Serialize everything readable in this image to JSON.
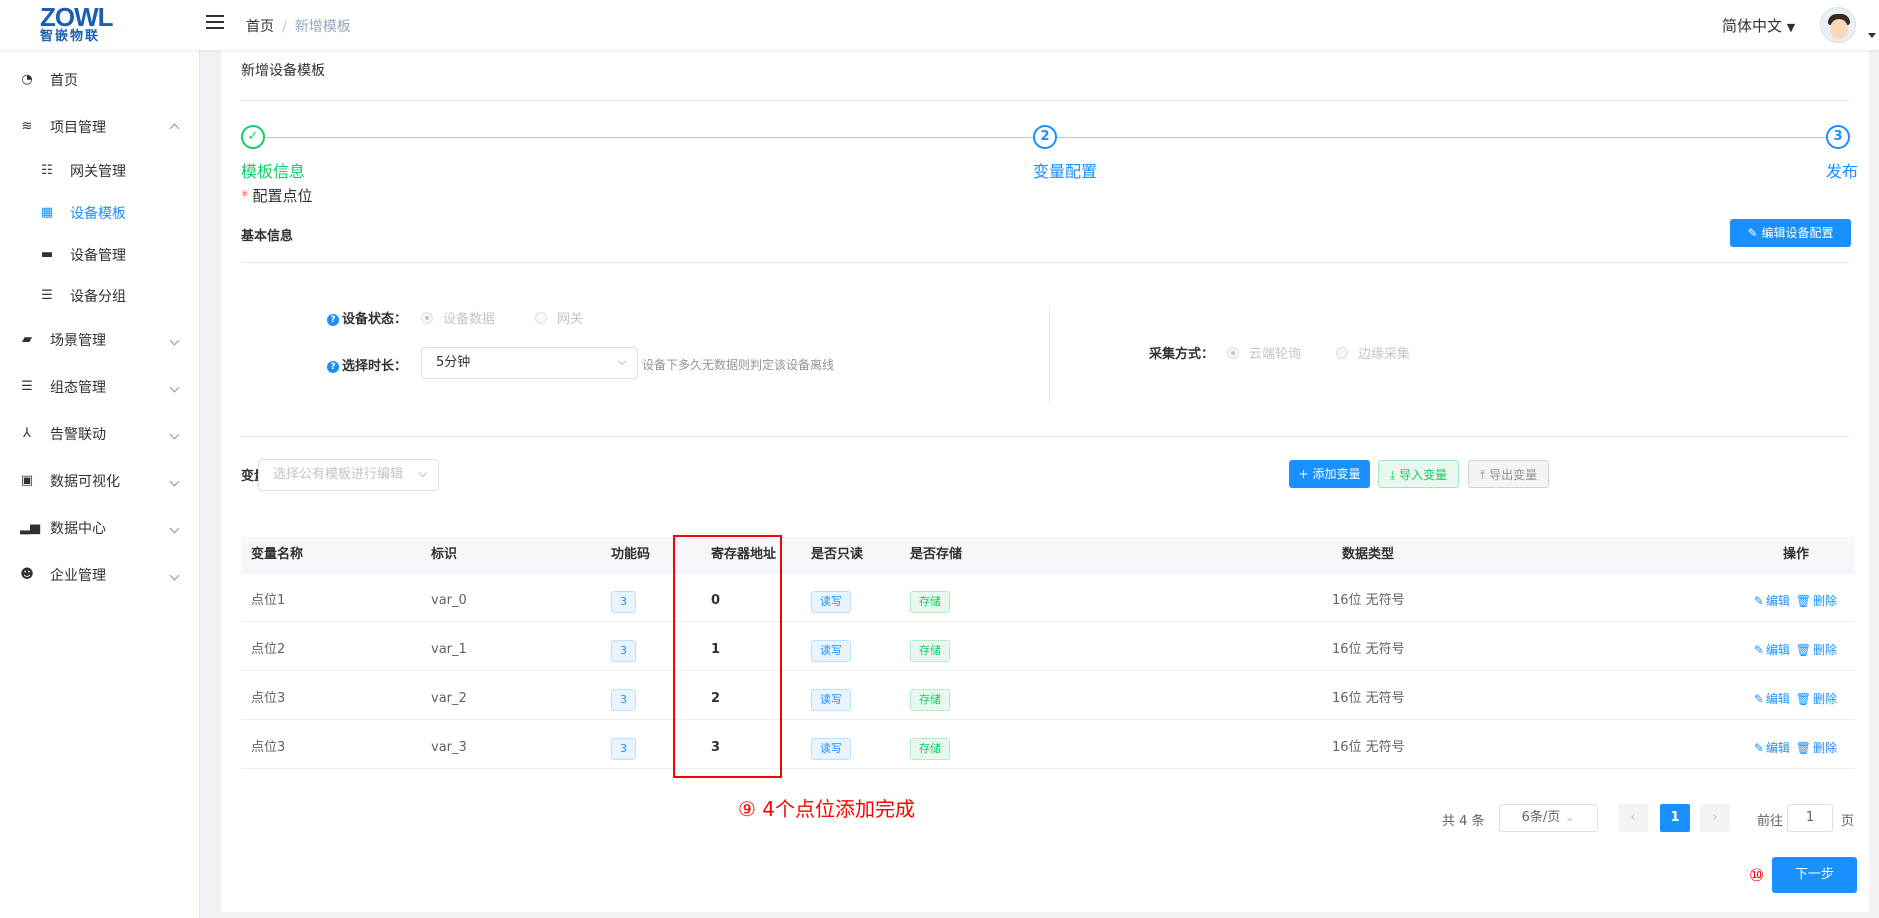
{
  "brand": {
    "logo_text": "ZOWL",
    "logo_sub": "智嵌物联"
  },
  "header": {
    "breadcrumb": [
      "首页",
      "新增模板"
    ],
    "language": "简体中文"
  },
  "sidebar": {
    "items": [
      {
        "label": "首页",
        "icon": "dashboard-icon"
      },
      {
        "label": "项目管理",
        "icon": "layers-icon"
      },
      {
        "label": "网关管理",
        "icon": "tree-icon"
      },
      {
        "label": "设备模板",
        "icon": "grid-icon"
      },
      {
        "label": "设备管理",
        "icon": "server-icon"
      },
      {
        "label": "设备分组",
        "icon": "list-icon"
      },
      {
        "label": "场景管理",
        "icon": "clapper-icon"
      },
      {
        "label": "组态管理",
        "icon": "list-icon"
      },
      {
        "label": "告警联动",
        "icon": "share-icon"
      },
      {
        "label": "数据可视化",
        "icon": "monitor-icon"
      },
      {
        "label": "数据中心",
        "icon": "bar-chart-icon"
      },
      {
        "label": "企业管理",
        "icon": "user-gear-icon"
      }
    ]
  },
  "page": {
    "title": "新增设备模板",
    "steps": [
      {
        "num": "1",
        "label": "模板信息",
        "status": "done"
      },
      {
        "num": "2",
        "label": "变量配置",
        "status": "active"
      },
      {
        "num": "3",
        "label": "发布",
        "status": "wait"
      }
    ],
    "step_desc_star": "*",
    "step_desc": "配置点位",
    "basic_info_title": "基本信息",
    "edit_config_button": "编辑设备配置",
    "device_status_label": "设备状态：",
    "device_status_options": [
      "设备数据",
      "网关"
    ],
    "duration_label": "选择时长：",
    "duration_value": "5分钟",
    "duration_hint": "设备下多久无数据则判定该设备离线",
    "collect_label": "采集方式：",
    "collect_options": [
      "云端轮询",
      "边缘采集"
    ],
    "var_list_title": "变量列表",
    "template_select_placeholder": "选择公有模板进行编辑",
    "add_var_button": "添加变量",
    "import_var_button": "导入变量",
    "export_var_button": "导出变量",
    "next_button": "下一步",
    "annotation_9": "⑨ 4个点位添加完成",
    "annotation_10": "⑩"
  },
  "table": {
    "headers": [
      "变量名称",
      "标识",
      "功能码",
      "寄存器地址",
      "是否只读",
      "是否存储",
      "数据类型",
      "操作"
    ],
    "rows": [
      {
        "name": "点位1",
        "id": "var_0",
        "func": "3",
        "addr": "0",
        "rw": "读写",
        "store": "存储",
        "dtype": "16位 无符号"
      },
      {
        "name": "点位2",
        "id": "var_1",
        "func": "3",
        "addr": "1",
        "rw": "读写",
        "store": "存储",
        "dtype": "16位 无符号"
      },
      {
        "name": "点位3",
        "id": "var_2",
        "func": "3",
        "addr": "2",
        "rw": "读写",
        "store": "存储",
        "dtype": "16位 无符号"
      },
      {
        "name": "点位3",
        "id": "var_3",
        "func": "3",
        "addr": "3",
        "rw": "读写",
        "store": "存储",
        "dtype": "16位 无符号"
      }
    ],
    "edit_label": "编辑",
    "delete_label": "删除"
  },
  "pagination": {
    "total": "共 4 条",
    "page_size": "6条/页",
    "current_page": "1",
    "goto_label": "前往",
    "goto_value": "1",
    "page_suffix": "页"
  },
  "colors": {
    "primary": "#1890ff",
    "success": "#13ce66",
    "annotation": "#ff0000"
  }
}
